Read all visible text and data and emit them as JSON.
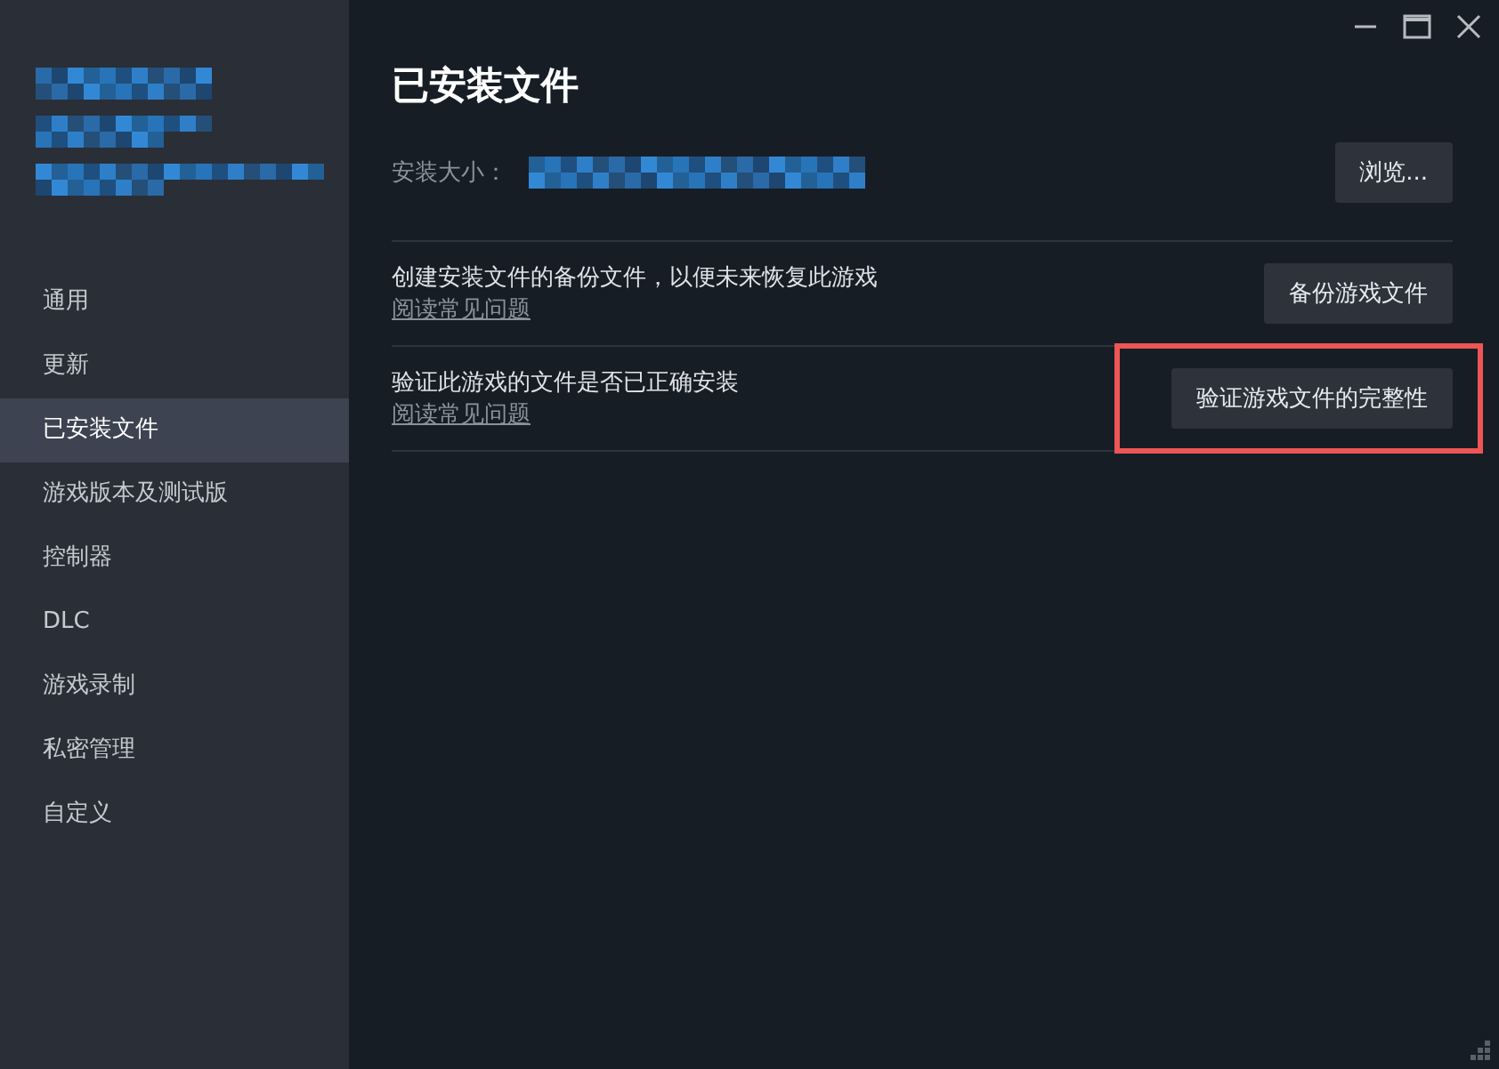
{
  "sidebar": {
    "items": [
      {
        "label": "通用",
        "selected": false
      },
      {
        "label": "更新",
        "selected": false
      },
      {
        "label": "已安装文件",
        "selected": true
      },
      {
        "label": "游戏版本及测试版",
        "selected": false
      },
      {
        "label": "控制器",
        "selected": false
      },
      {
        "label": "DLC",
        "selected": false
      },
      {
        "label": "游戏录制",
        "selected": false
      },
      {
        "label": "私密管理",
        "selected": false
      },
      {
        "label": "自定义",
        "selected": false
      }
    ]
  },
  "title": "已安装文件",
  "install_size": {
    "label": "安装大小：",
    "button": "浏览..."
  },
  "rows": [
    {
      "text": "创建安装文件的备份文件，以便未来恢复此游戏",
      "link": "阅读常见问题",
      "button": "备份游戏文件",
      "highlighted": false
    },
    {
      "text": "验证此游戏的文件是否已正确安装",
      "link": "阅读常见问题",
      "button": "验证游戏文件的完整性",
      "highlighted": true
    }
  ]
}
